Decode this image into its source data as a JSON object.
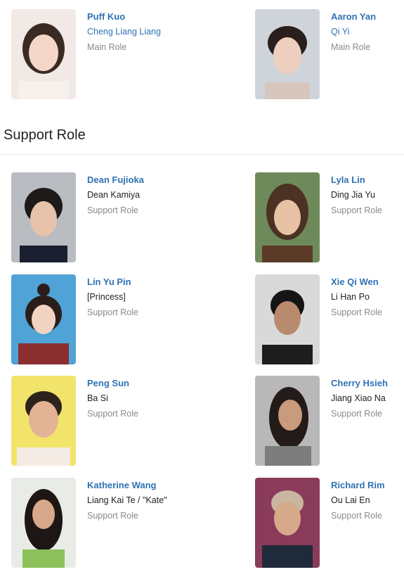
{
  "main_cast": [
    {
      "name": "Puff Kuo",
      "character": "Cheng Liang Liang",
      "role": "Main Role"
    },
    {
      "name": "Aaron Yan",
      "character": "Qi Yi",
      "role": "Main Role"
    }
  ],
  "support": {
    "heading": "Support Role",
    "cast": [
      {
        "name": "Dean Fujioka",
        "character": "Dean Kamiya",
        "role": "Support Role"
      },
      {
        "name": "Lyla Lin",
        "character": "Ding Jia Yu",
        "role": "Support Role"
      },
      {
        "name": "Lin Yu Pin",
        "character": "[Princess]",
        "role": "Support Role"
      },
      {
        "name": "Xie Qi Wen",
        "character": "Li Han Po",
        "role": "Support Role"
      },
      {
        "name": "Peng Sun",
        "character": "Ba Si",
        "role": "Support Role"
      },
      {
        "name": "Cherry Hsieh",
        "character": "Jiang Xiao Na",
        "role": "Support Role"
      },
      {
        "name": "Katherine Wang",
        "character": "Liang Kai Te / \"Kate\"",
        "role": "Support Role"
      },
      {
        "name": "Richard Rim",
        "character": "Ou Lai En",
        "role": "Support Role"
      }
    ]
  },
  "colors": {
    "link": "#2f72b3",
    "muted": "#8a8a8a",
    "divider": "#e6e6e6"
  }
}
